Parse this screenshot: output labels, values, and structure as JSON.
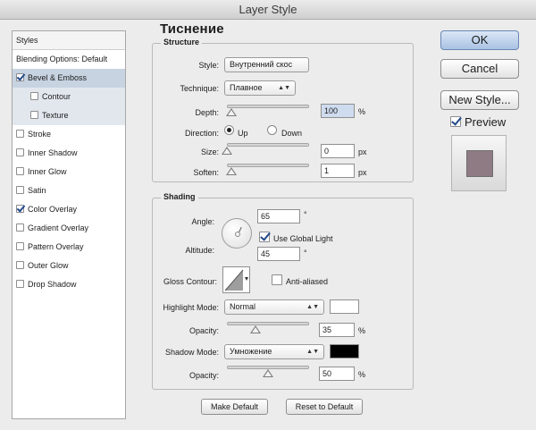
{
  "window": {
    "title": "Layer Style"
  },
  "styles_list": {
    "header": "Styles",
    "items": [
      {
        "label": "Blending Options: Default",
        "checkbox": false,
        "checked": false
      },
      {
        "label": "Bevel & Emboss",
        "checkbox": true,
        "checked": true
      },
      {
        "label": "Contour",
        "checkbox": true,
        "checked": false
      },
      {
        "label": "Texture",
        "checkbox": true,
        "checked": false
      },
      {
        "label": "Stroke",
        "checkbox": true,
        "checked": false
      },
      {
        "label": "Inner Shadow",
        "checkbox": true,
        "checked": false
      },
      {
        "label": "Inner Glow",
        "checkbox": true,
        "checked": false
      },
      {
        "label": "Satin",
        "checkbox": true,
        "checked": false
      },
      {
        "label": "Color Overlay",
        "checkbox": true,
        "checked": true
      },
      {
        "label": "Gradient Overlay",
        "checkbox": true,
        "checked": false
      },
      {
        "label": "Pattern Overlay",
        "checkbox": true,
        "checked": false
      },
      {
        "label": "Outer Glow",
        "checkbox": true,
        "checked": false
      },
      {
        "label": "Drop Shadow",
        "checkbox": true,
        "checked": false
      }
    ]
  },
  "panel": {
    "title": "Тиснение",
    "structure": {
      "title": "Structure",
      "style_label": "Style:",
      "style_value": "Внутренний скос",
      "technique_label": "Technique:",
      "technique_value": "Плавное",
      "depth_label": "Depth:",
      "depth_value": "100",
      "depth_unit": "%",
      "depth_level": 0.05,
      "direction_label": "Direction:",
      "direction_up": "Up",
      "direction_down": "Down",
      "direction_selected": "Up",
      "size_label": "Size:",
      "size_value": "0",
      "size_unit": "px",
      "soften_label": "Soften:",
      "soften_value": "1",
      "soften_unit": "px"
    },
    "shading": {
      "title": "Shading",
      "angle_label": "Angle:",
      "angle_value": "65",
      "degree_symbol": "°",
      "use_global_light_label": "Use Global Light",
      "use_global_light_checked": true,
      "altitude_label": "Altitude:",
      "altitude_value": "45",
      "gloss_contour_label": "Gloss Contour:",
      "anti_aliased_label": "Anti-aliased",
      "anti_aliased_checked": false,
      "highlight_mode_label": "Highlight Mode:",
      "highlight_mode_value": "Normal",
      "highlight_color": "#ffffff",
      "highlight_opacity_label": "Opacity:",
      "highlight_opacity_value": "35",
      "shadow_mode_label": "Shadow Mode:",
      "shadow_mode_value": "Умножение",
      "shadow_color": "#000000",
      "shadow_opacity_label": "Opacity:",
      "shadow_opacity_value": "50",
      "percent": "%"
    },
    "make_default": "Make Default",
    "reset_to_default": "Reset to Default"
  },
  "right": {
    "ok": "OK",
    "cancel": "Cancel",
    "new_style": "New Style...",
    "preview_label": "Preview",
    "preview_checked": true,
    "preview_color": "#8f7b84"
  }
}
